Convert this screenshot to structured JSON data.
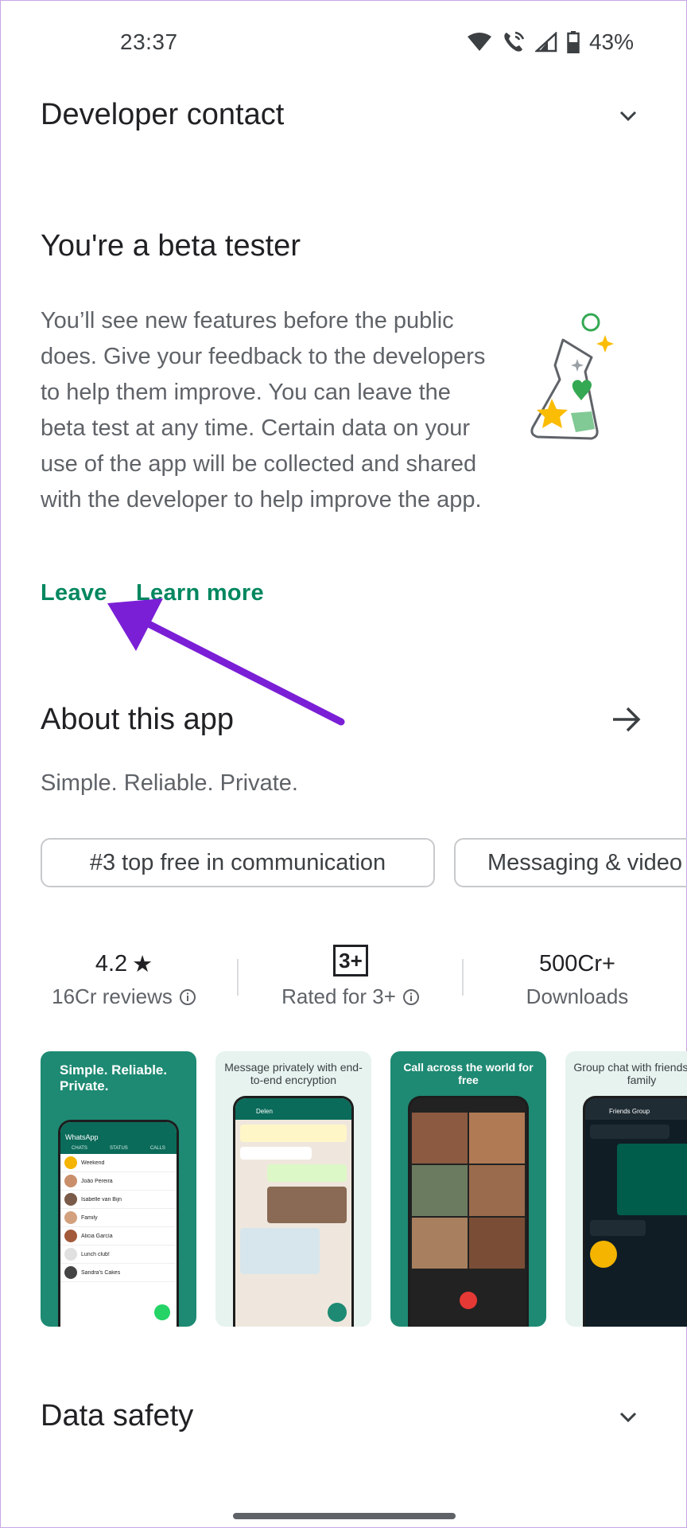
{
  "status_bar": {
    "time": "23:37",
    "battery": "43%"
  },
  "developer_contact": {
    "title": "Developer contact"
  },
  "beta": {
    "title": "You're a beta tester",
    "description": "You’ll see new features before the public does. Give your feedback to the developers to help them improve. You can leave the beta test at any time. Certain data on your use of the app will be collected and shared with the developer to help improve the app.",
    "leave_label": "Leave",
    "learn_more_label": "Learn more"
  },
  "about": {
    "title": "About this app",
    "tagline": "Simple. Reliable. Private.",
    "chips": [
      "#3 top free in communication",
      "Messaging & video"
    ]
  },
  "stats": {
    "rating": "4.2",
    "reviews": "16Cr reviews",
    "content_rating_badge": "3+",
    "content_rating_label": "Rated for 3+",
    "downloads": "500Cr+",
    "downloads_label": "Downloads"
  },
  "screenshots": [
    {
      "caption": "Simple. Reliable. Private.",
      "bg": "#1e8a73"
    },
    {
      "caption": "Message privately with end-to-end encryption",
      "bg": "#e6f3ef"
    },
    {
      "caption": "Call across the world for free",
      "bg": "#1e8a73"
    },
    {
      "caption": "Group chat with friends and family",
      "bg": "#e6f3ef"
    }
  ],
  "screenshot1": {
    "app_name": "WhatsApp",
    "tabs": [
      "CHATS",
      "STATUS",
      "CALLS"
    ],
    "chats": [
      "Weekend",
      "João Pereira",
      "Isabelle van Bijn",
      "Family",
      "Alicia García",
      "Lunch club!",
      "Sandra's Cakes"
    ]
  },
  "screenshot2": {
    "contact": "Delen"
  },
  "screenshot4": {
    "group": "Friends Group"
  },
  "data_safety": {
    "title": "Data safety"
  },
  "colors": {
    "accent_green": "#01875f",
    "annotation_arrow": "#7a1fd6"
  }
}
